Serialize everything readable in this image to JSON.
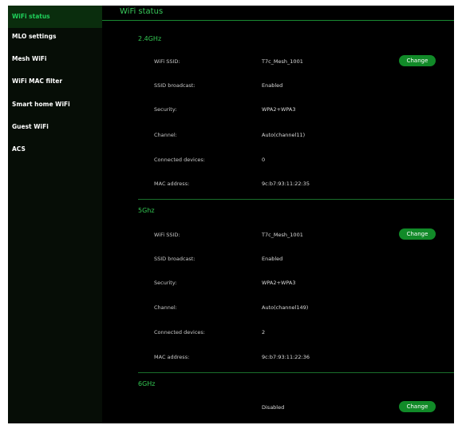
{
  "sidebar": {
    "items": [
      {
        "label": "WiFi status"
      },
      {
        "label": "MLO settings"
      },
      {
        "label": "Mesh WiFi"
      },
      {
        "label": "WiFi MAC filter"
      },
      {
        "label": "Smart home WiFi"
      },
      {
        "label": "Guest WiFi"
      },
      {
        "label": "ACS"
      }
    ]
  },
  "main": {
    "title": "WiFi status",
    "labels": {
      "ssid": "WiFi SSID:",
      "broadcast": "SSID broadcast:",
      "security": "Security:",
      "channel": "Channel:",
      "devices": "Connected devices:",
      "mac": "MAC address:"
    },
    "change_label": "Change",
    "bands": [
      {
        "name": "2.4GHz",
        "ssid": "T7c_Mesh_1001",
        "broadcast": "Enabled",
        "security": "WPA2+WPA3",
        "channel": "Auto(channel11)",
        "devices": "0",
        "mac": "9c:b7:93:11:22:35"
      },
      {
        "name": "5Ghz",
        "ssid": "T7c_Mesh_1001",
        "broadcast": "Enabled",
        "security": "WPA2+WPA3",
        "channel": "Auto(channel149)",
        "devices": "2",
        "mac": "9c:b7:93:11:22:36"
      },
      {
        "name": "6GHz",
        "status": "Disabled"
      }
    ]
  },
  "colors": {
    "accent": "#33c652",
    "button": "#118a28",
    "active_bg": "#0a2d0d"
  }
}
